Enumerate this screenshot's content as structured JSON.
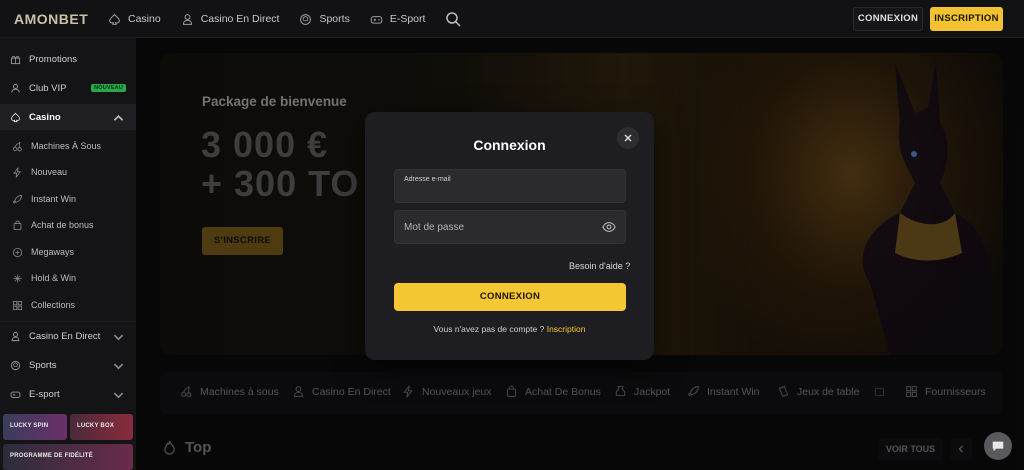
{
  "brand": {
    "logo": "AMONBET"
  },
  "topnav": {
    "items": [
      {
        "label": "Casino",
        "icon": "spade-icon"
      },
      {
        "label": "Casino En Direct",
        "icon": "dealer-icon"
      },
      {
        "label": "Sports",
        "icon": "ball-icon"
      },
      {
        "label": "E-Sport",
        "icon": "gamepad-icon"
      }
    ],
    "login_label": "CONNEXION",
    "register_label": "INSCRIPTION"
  },
  "sidebar": {
    "items": [
      {
        "label": "Promotions",
        "icon": "gift-icon"
      },
      {
        "label": "Club VIP",
        "icon": "user-icon",
        "badge": "NOUVEAU"
      },
      {
        "label": "Casino",
        "icon": "spade-icon",
        "active": true
      },
      {
        "label": "Machines À Sous",
        "icon": "cherry-icon"
      },
      {
        "label": "Nouveau",
        "icon": "bolt-icon"
      },
      {
        "label": "Instant Win",
        "icon": "rocket-icon"
      },
      {
        "label": "Achat de bonus",
        "icon": "bag-icon"
      },
      {
        "label": "Megaways",
        "icon": "ways-icon"
      },
      {
        "label": "Hold & Win",
        "icon": "coins-icon"
      },
      {
        "label": "Collections",
        "icon": "grid-icon"
      },
      {
        "label": "Casino En Direct",
        "icon": "dealer-icon"
      },
      {
        "label": "Sports",
        "icon": "ball-icon"
      },
      {
        "label": "E-sport",
        "icon": "gamepad-icon"
      }
    ],
    "promos": [
      {
        "label": "LUCKY SPIN"
      },
      {
        "label": "LUCKY BOX"
      },
      {
        "label": "PROGRAMME DE FIDÉLITÉ"
      }
    ]
  },
  "hero": {
    "subtitle": "Package de bienvenue",
    "line1": "3 000 €",
    "line2": "+ 300 TO",
    "cta": "S'INSCRIRE"
  },
  "categories": [
    {
      "label": "Machines à sous",
      "icon": "cherry-icon"
    },
    {
      "label": "Casino En Direct",
      "icon": "dealer-icon"
    },
    {
      "label": "Nouveaux jeux",
      "icon": "bolt-icon"
    },
    {
      "label": "Achat De Bonus",
      "icon": "bag-icon"
    },
    {
      "label": "Jackpot",
      "icon": "money-icon"
    },
    {
      "label": "Instant Win",
      "icon": "rocket-icon"
    },
    {
      "label": "Jeux de table",
      "icon": "chip-icon"
    },
    {
      "label": "Fournisseurs",
      "icon": "grid-icon"
    }
  ],
  "section": {
    "title": "Top",
    "see_all": "VOIR TOUS"
  },
  "modal": {
    "title": "Connexion",
    "email_label": "Adresse e-mail",
    "email_value": "",
    "password_placeholder": "Mot de passe",
    "help": "Besoin d'aide ?",
    "submit": "CONNEXION",
    "no_account": "Vous n'avez pas de compte ?",
    "signup_link": "Inscription"
  },
  "colors": {
    "accent": "#f5c732",
    "new_badge": "#27a84a"
  }
}
